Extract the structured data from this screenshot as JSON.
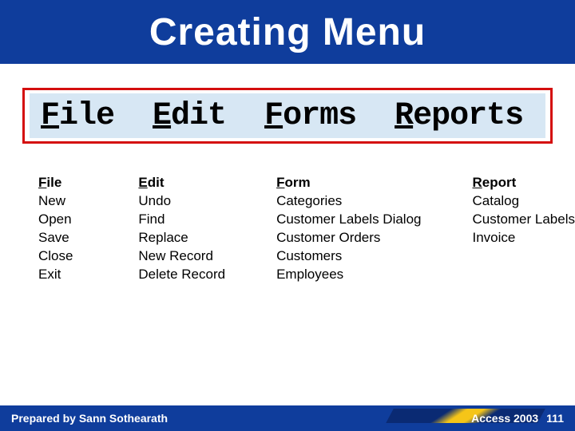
{
  "title": "Creating Menu",
  "menubar": {
    "file": {
      "mnemonic": "F",
      "rest": "ile"
    },
    "edit": {
      "mnemonic": "E",
      "rest": "dit"
    },
    "forms": {
      "mnemonic": "F",
      "rest": "orms"
    },
    "reports": {
      "mnemonic": "R",
      "rest": "eports"
    }
  },
  "lists": {
    "file": {
      "heading_mn": "F",
      "heading_rest": "ile",
      "items": [
        "New",
        "Open",
        "Save",
        "Close",
        "Exit"
      ]
    },
    "edit": {
      "heading_mn": "E",
      "heading_rest": "dit",
      "items": [
        "Undo",
        "Find",
        "Replace",
        "New Record",
        "Delete Record"
      ]
    },
    "form": {
      "heading_mn": "F",
      "heading_rest": "orm",
      "items": [
        "Categories",
        "Customer Labels Dialog",
        "Customer Orders",
        "Customers",
        "Employees"
      ]
    },
    "report": {
      "heading_mn": "R",
      "heading_rest": "eport",
      "items": [
        "Catalog",
        "Customer Labels",
        "Invoice"
      ]
    }
  },
  "footer": {
    "prepared": "Prepared by Sann Sothearath",
    "product": "Access 2003",
    "page": "111"
  }
}
